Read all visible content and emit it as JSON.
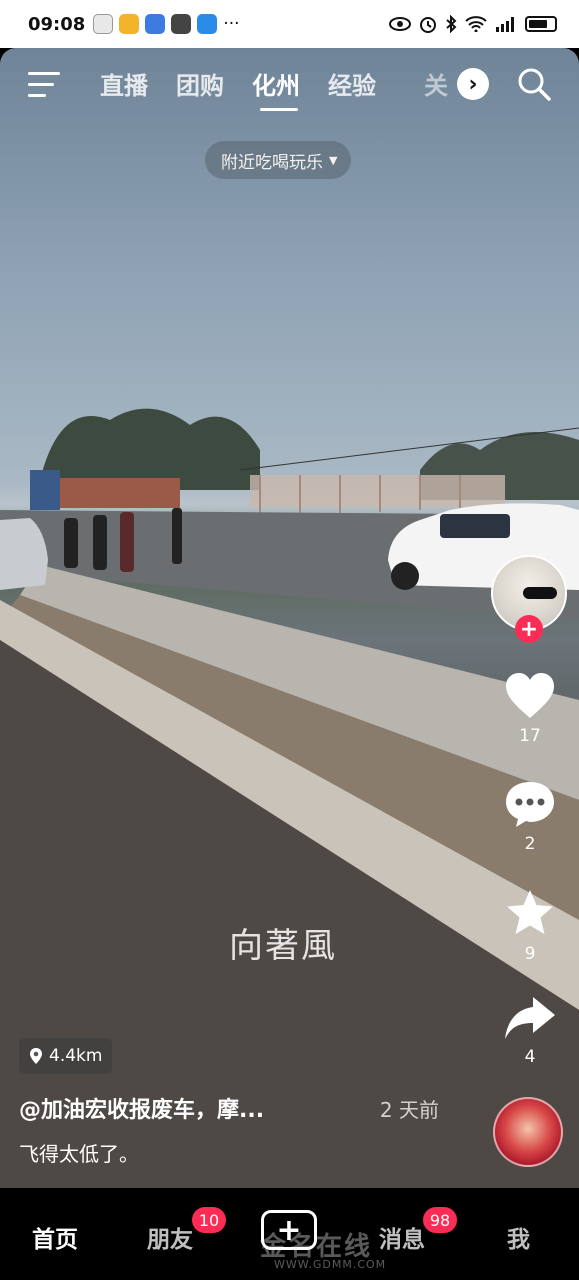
{
  "status_bar": {
    "time": "09:08",
    "more": "···"
  },
  "top_nav": {
    "tabs": [
      {
        "label": "直播"
      },
      {
        "label": "团购"
      },
      {
        "label": "化州"
      },
      {
        "label": "经验"
      }
    ],
    "overflow_tab": "关",
    "active_tab": "化州",
    "more_button": "›"
  },
  "nearby_pill": {
    "label": "附近吃喝玩乐",
    "caret": "▼"
  },
  "actions": {
    "follow": "+",
    "likes": "17",
    "comments": "2",
    "favorites": "9",
    "shares": "4"
  },
  "video_caption": "向著風",
  "location": {
    "distance": "4.4km"
  },
  "post": {
    "author": "@加油宏收报废车，摩...",
    "time_ago": "2 天前",
    "description": "飞得太低了。"
  },
  "bottom_nav": {
    "home": "首页",
    "friends": "朋友",
    "friends_badge": "10",
    "create": "+",
    "messages": "消息",
    "messages_badge": "98",
    "me": "我"
  },
  "site_watermark": {
    "name": "金名在线",
    "url": "WWW.GDMM.COM"
  },
  "colors": {
    "accent": "#fe2c55",
    "nav_bg": "#000000"
  }
}
